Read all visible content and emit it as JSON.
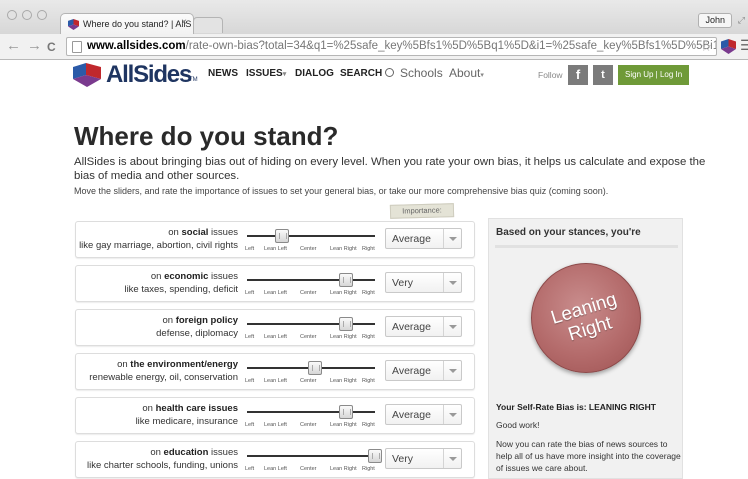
{
  "browser": {
    "tab_title": "Where do you stand? | AllS",
    "tab_close": "×",
    "profile_name": "John",
    "back": "←",
    "forward": "→",
    "reload": "C",
    "url_host": "www.allsides.com",
    "url_path": "/rate-own-bias?total=34&q1=%25safe_key%5Bfs1%5D%5Bq1%5D&i1=%25safe_key%5Bfs1%5D%5Bi1%5D&q2=%25safe…",
    "star": "☆",
    "menu": "☰",
    "resize": "⤢"
  },
  "site": {
    "logo": "AllSides",
    "logo_tm": "TM",
    "nav": {
      "news": "NEWS",
      "issues": "ISSUES",
      "dialog": "DIALOG",
      "search": "SEARCH",
      "schools": "Schools",
      "about": "About"
    },
    "caret": "▾",
    "follow": "Follow",
    "facebook": "f",
    "twitter": "t",
    "signup": "Sign Up | Log In"
  },
  "page": {
    "title": "Where do you stand?",
    "intro": "AllSides is about bringing bias out of hiding on every level. When you rate your own bias, it helps us calculate and expose the bias of media and other sources.",
    "instructions": "Move the sliders, and rate the importance of issues to set your general bias, or take our more comprehensive bias quiz (coming soon).",
    "importance_label": "Importance:"
  },
  "slider_scale": [
    "Left",
    "Lean Left",
    "Center",
    "Lean Right",
    "Right"
  ],
  "issues": [
    {
      "prefix": "on ",
      "topic": "social",
      "suffix": " issues",
      "examples": "like gay marriage, abortion, civil rights",
      "position": 0.27,
      "importance": "Average"
    },
    {
      "prefix": "on ",
      "topic": "economic",
      "suffix": " issues",
      "examples": "like taxes, spending, deficit",
      "position": 0.77,
      "importance": "Very"
    },
    {
      "prefix": "on ",
      "topic": "foreign policy",
      "suffix": "",
      "examples": "defense, diplomacy",
      "position": 0.77,
      "importance": "Average"
    },
    {
      "prefix": "on ",
      "topic": "the environment/energy",
      "suffix": "",
      "examples": "renewable energy, oil, conservation",
      "position": 0.53,
      "importance": "Average"
    },
    {
      "prefix": "on ",
      "topic": "health care issues",
      "suffix": "",
      "examples": "like medicare, insurance",
      "position": 0.77,
      "importance": "Average"
    },
    {
      "prefix": "on ",
      "topic": "education",
      "suffix": " issues",
      "examples": "like charter schools, funding, unions",
      "position": 1.0,
      "importance": "Very"
    }
  ],
  "result": {
    "heading": "Based on your stances, you're",
    "badge": "Leaning Right",
    "self_rate": "Your Self-Rate Bias is: LEANING RIGHT",
    "good": "Good work!",
    "note": "Now you can rate the bias of news sources to help all of us have more insight into the coverage of issues we care about."
  },
  "colors": {
    "brand_navy": "#1f3561",
    "signup_green": "#6f9a38",
    "badge_red": "#b46b6b"
  }
}
